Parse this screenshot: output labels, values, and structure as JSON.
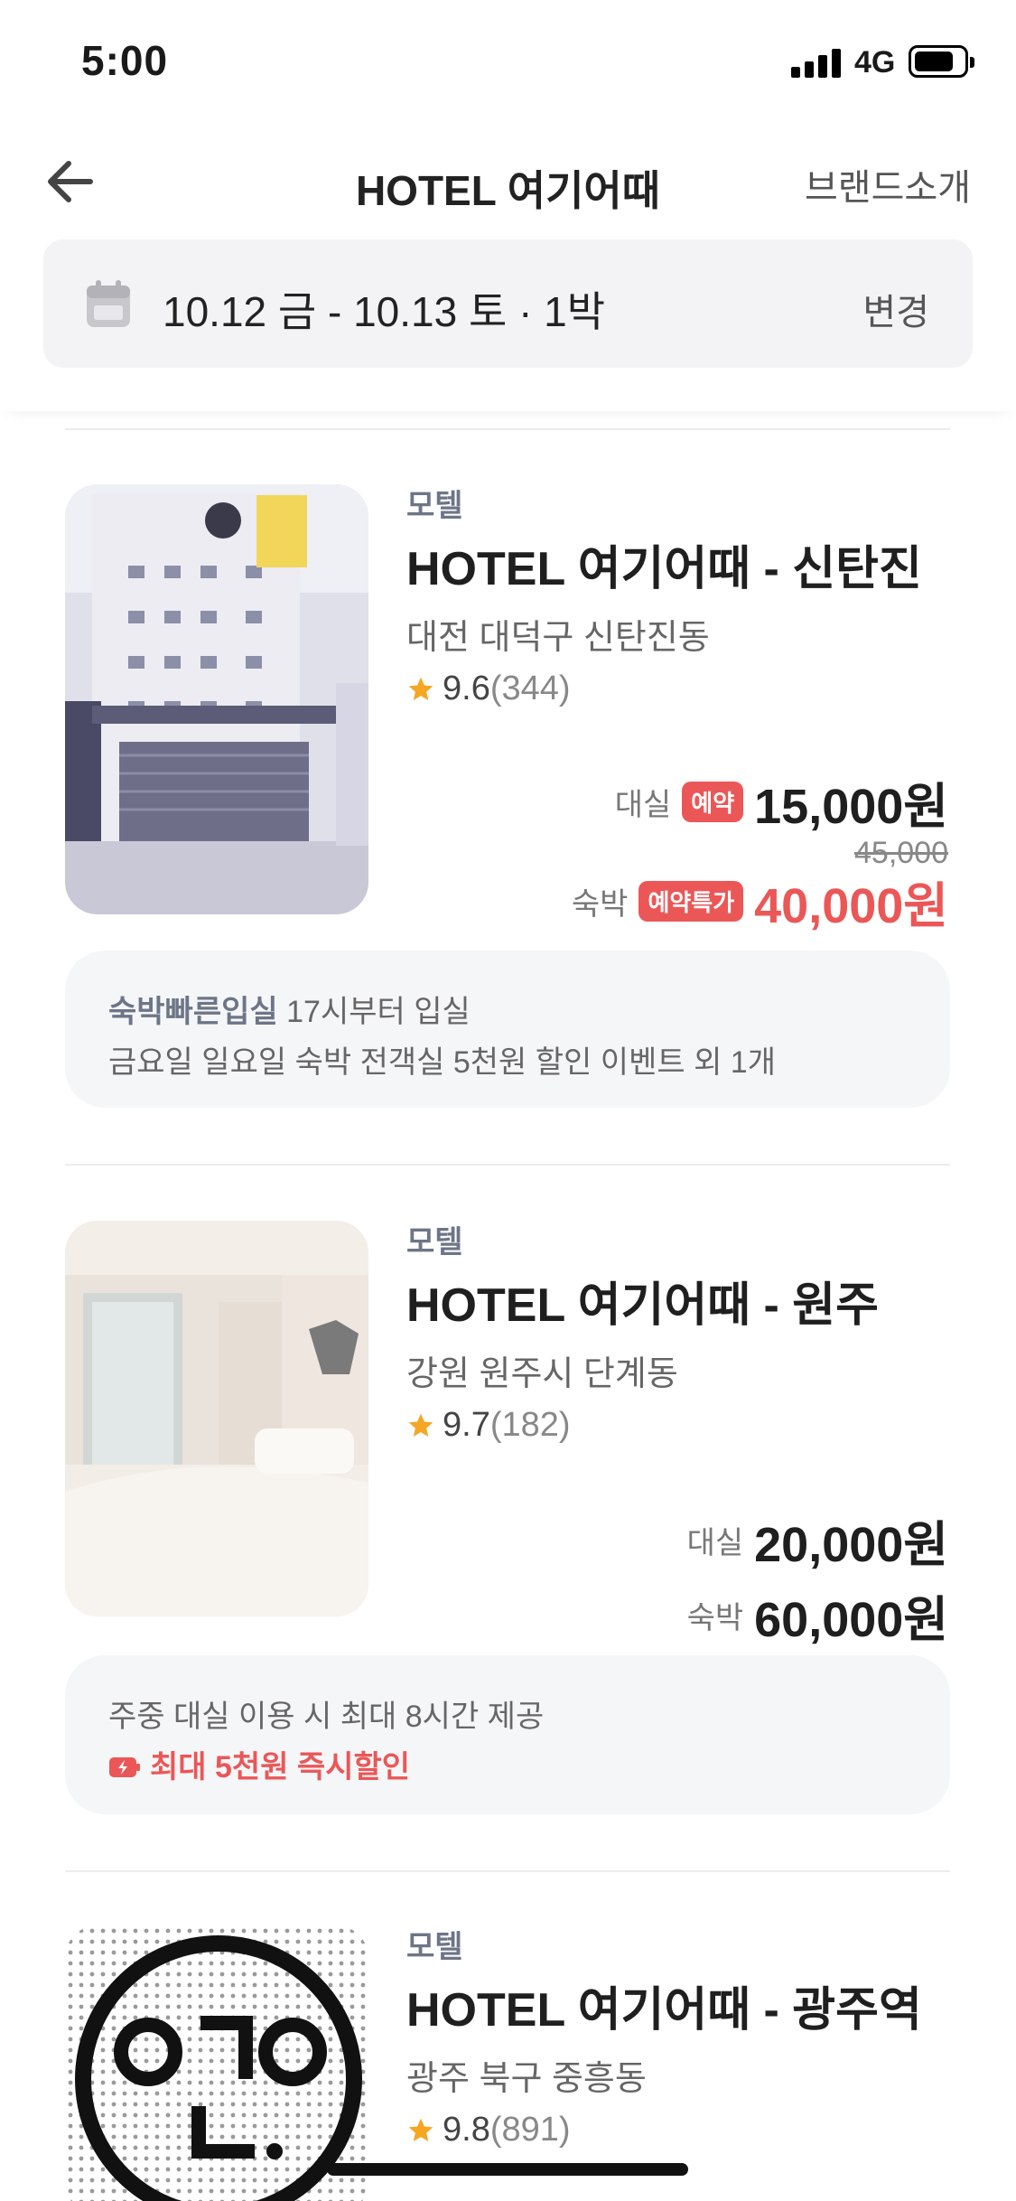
{
  "status_bar": {
    "time": "5:00",
    "network": "4G"
  },
  "header": {
    "title": "HOTEL 여기어때",
    "brand_link": "브랜드소개"
  },
  "date_bar": {
    "date_text": "10.12 금 - 10.13 토 · 1박",
    "change_label": "변경"
  },
  "hotels": [
    {
      "category": "모텔",
      "name": "HOTEL 여기어때 - 신탄진",
      "location": "대전 대덕구 신탄진동",
      "score": "9.6",
      "review_count": "(344)",
      "prices": {
        "rest_label": "대실",
        "rest_badge": "예약",
        "rest_price": "15,000원",
        "original_price": "45,000",
        "stay_label": "숙박",
        "stay_badge": "예약특가",
        "stay_price": "40,000원"
      },
      "notice": {
        "highlight": "숙박빠른입실",
        "highlight_text": " 17시부터 입실",
        "line2": "금요일 일요일 숙박 전객실 5천원 할인 이벤트 외 1개"
      }
    },
    {
      "category": "모텔",
      "name": "HOTEL 여기어때 - 원주",
      "location": "강원 원주시 단계동",
      "score": "9.7",
      "review_count": "(182)",
      "prices": {
        "rest_label": "대실",
        "rest_price": "20,000원",
        "stay_label": "숙박",
        "stay_price": "60,000원"
      },
      "notice": {
        "line1": "주중 대실 이용 시 최대 8시간 제공",
        "discount": "최대 5천원 즉시할인"
      }
    },
    {
      "category": "모텔",
      "name": "HOTEL 여기어때 - 광주역",
      "location": "광주 북구 중흥동",
      "score": "9.8",
      "review_count": "(891)"
    }
  ],
  "colors": {
    "accent_red": "#eb5757",
    "star": "#f5a623",
    "category_gray": "#6d7587"
  }
}
